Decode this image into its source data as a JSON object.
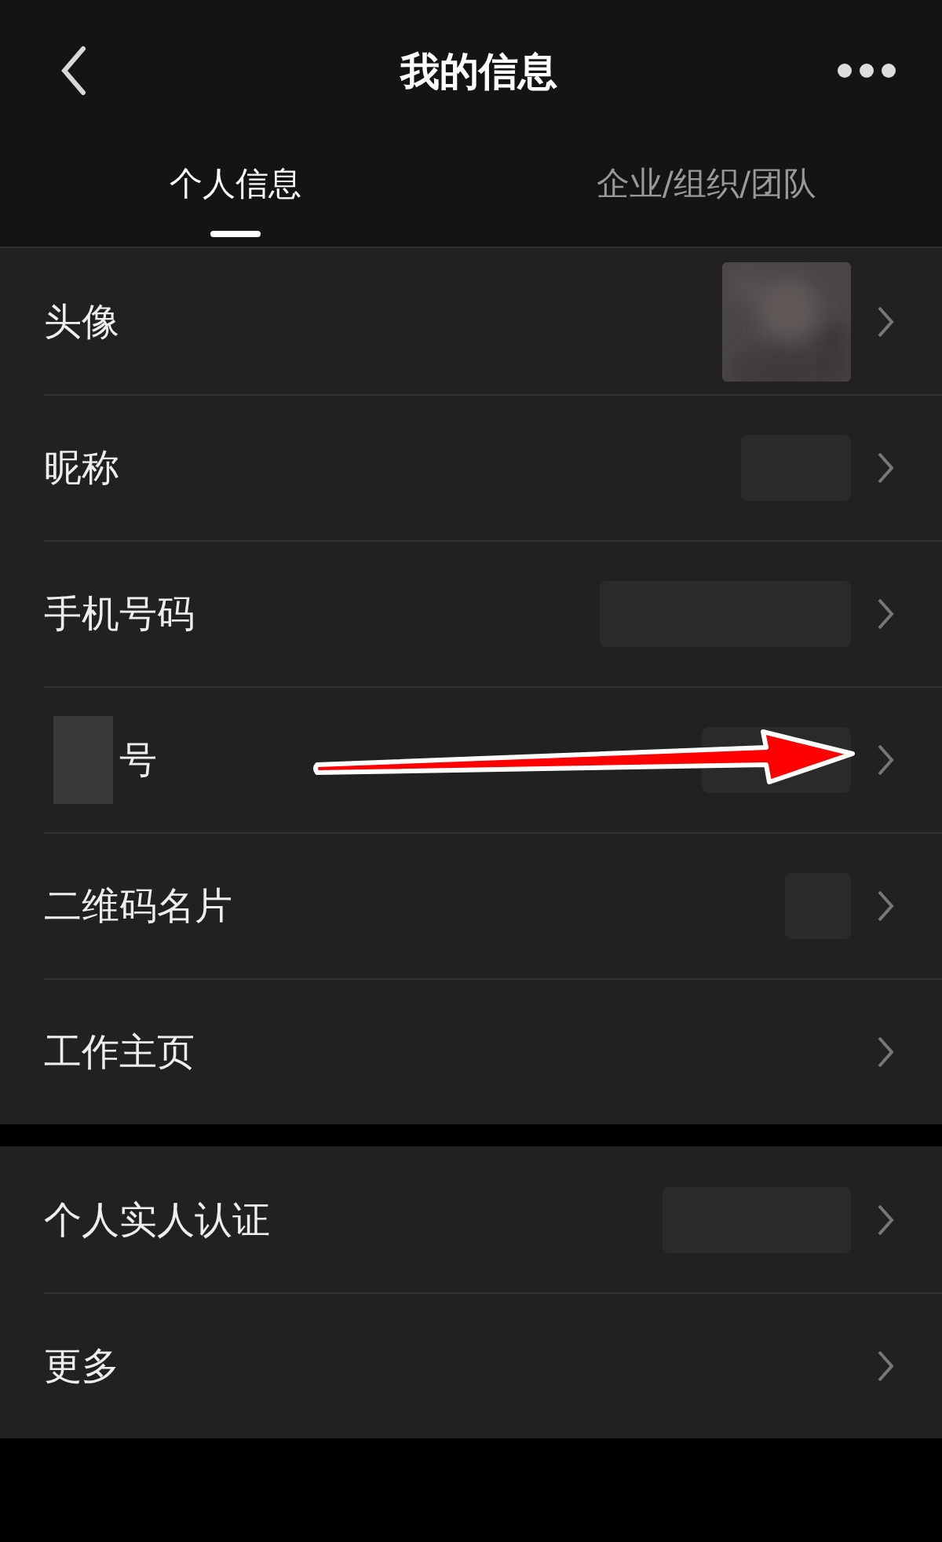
{
  "header": {
    "title": "我的信息"
  },
  "tabs": [
    {
      "label": "个人信息",
      "selected": true
    },
    {
      "label": "企业/组织/团队",
      "selected": false
    }
  ],
  "sections": [
    {
      "rows": [
        {
          "label": "头像",
          "kind": "avatar"
        },
        {
          "label": "昵称",
          "kind": "redacted"
        },
        {
          "label": "手机号码",
          "kind": "redacted"
        },
        {
          "label": "号",
          "label_redacted": true,
          "kind": "redacted"
        },
        {
          "label": "二维码名片",
          "kind": "redacted"
        },
        {
          "label": "工作主页",
          "kind": "plain"
        }
      ]
    },
    {
      "rows": [
        {
          "label": "个人实人认证",
          "kind": "redacted"
        },
        {
          "label": "更多",
          "kind": "plain"
        }
      ]
    }
  ]
}
